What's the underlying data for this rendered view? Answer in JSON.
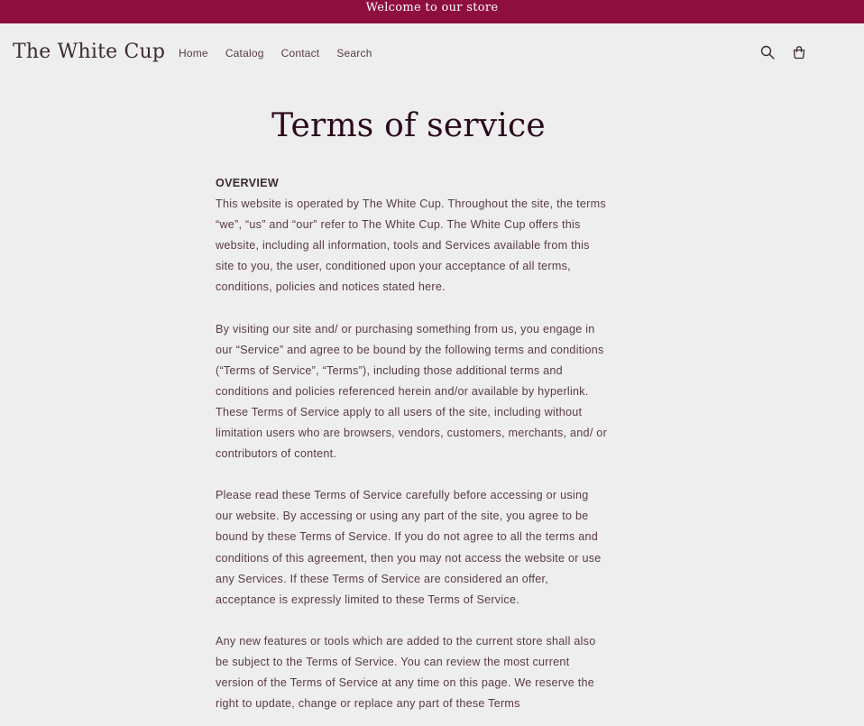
{
  "announcement": {
    "text": "Welcome to our store"
  },
  "header": {
    "logo": "The White Cup",
    "nav": [
      "Home",
      "Catalog",
      "Contact",
      "Search"
    ],
    "icons": {
      "search": "search-icon",
      "cart": "cart-icon"
    }
  },
  "page": {
    "title": "Terms of service",
    "section_heading": "OVERVIEW",
    "paragraphs": [
      "This website is operated by The White Cup. Throughout the site, the terms “we”, “us” and “our” refer to The White Cup. The White Cup offers this website, including all information, tools and Services available from this site to you, the user, conditioned upon your acceptance of all terms, conditions, policies and notices stated here.",
      "By visiting our site and/ or purchasing something from us, you engage in our “Service” and agree to be bound by the following terms and conditions (“Terms of Service”, “Terms”), including those additional terms and conditions and policies referenced herein and/or available by hyperlink. These Terms of Service apply to all users of the site, including without limitation users who are browsers, vendors, customers, merchants, and/ or contributors of content.",
      "Please read these Terms of Service carefully before accessing or using our website. By accessing or using any part of the site, you agree to be bound by these Terms of Service. If you do not agree to all the terms and conditions of this agreement, then you may not access the website or use any Services. If these Terms of Service are considered an offer, acceptance is expressly limited to these Terms of Service.",
      "Any new features or tools which are added to the current store shall also be subject to the Terms of Service. You can review the most current version of the Terms of Service at any time on this page. We reserve the right to update, change or replace any part of these Terms"
    ]
  },
  "colors": {
    "announcement_bg": "#8e0f3e",
    "page_bg": "#eeeeee",
    "title": "#2a0a1c",
    "body_text": "#5a3a48"
  }
}
